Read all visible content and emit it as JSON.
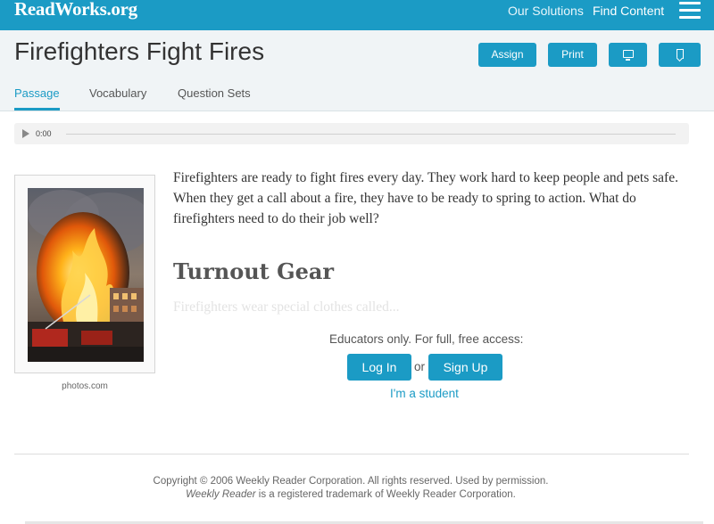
{
  "topbar": {
    "logo": "ReadWorks.org",
    "nav": [
      "Our Solutions",
      "Find Content"
    ],
    "menu_icon": "hamburger-icon"
  },
  "header": {
    "title": "Firefighters Fight Fires",
    "buttons": {
      "assign": "Assign",
      "print": "Print",
      "present_icon": "monitor-icon",
      "save_icon": "bookmark-icon"
    },
    "tabs": [
      "Passage",
      "Vocabulary",
      "Question Sets"
    ],
    "active_tab": "Passage"
  },
  "audio": {
    "time": "0:00",
    "progress": 0
  },
  "passage": {
    "image_credit": "photos.com",
    "intro": "Firefighters are ready to fight fires every day. They work hard to keep people and pets safe. When they get a call about a fire, they have to be ready to spring to action.  What do firefighters need to do their job well?",
    "heading": "Turnout Gear",
    "faded_text": "Firefighters wear special clothes called..."
  },
  "gate": {
    "message": "Educators only. For full, free access:",
    "login": "Log In",
    "or": "or",
    "signup": "Sign Up",
    "student": "I'm a student"
  },
  "footer": {
    "line1": "Copyright © 2006 Weekly Reader Corporation. All rights reserved. Used by permission.",
    "line2_italic": "Weekly Reader",
    "line2_rest": " is a registered trademark of Weekly Reader Corporation."
  },
  "colors": {
    "brand": "#1b9bc5",
    "header_bg": "#f0f4f6"
  }
}
